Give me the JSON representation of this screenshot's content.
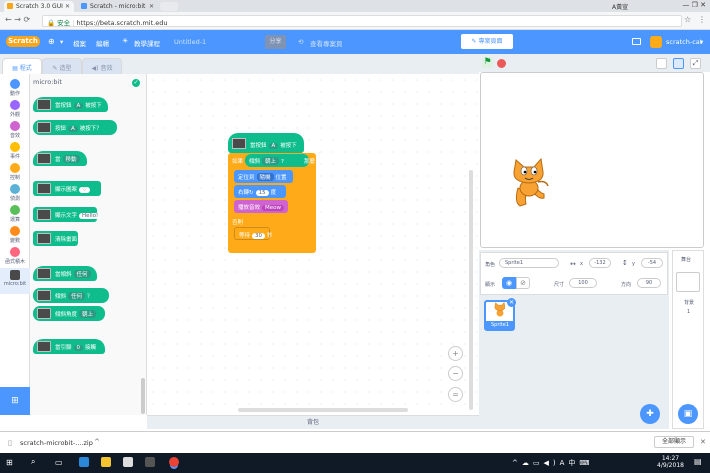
{
  "browser": {
    "tabs": [
      {
        "label": "Scratch 3.0 GUI",
        "active": true
      },
      {
        "label": "Scratch - micro:bit",
        "active": false
      }
    ],
    "user_label": "A黃宣",
    "secure_label": "安全",
    "url": "https://beta.scratch.mit.edu",
    "win_controls": "—  ❐  ✕"
  },
  "menubar": {
    "logo": "Scratch",
    "items": [
      "檔案",
      "編輯",
      "教學課程"
    ],
    "project_title": "Untitled-1",
    "share_label": "分享",
    "remix_label": "查看專案頁",
    "project_page_label": "專案頁面",
    "username": "scratch-cat"
  },
  "editor_tabs": [
    "程式",
    "造型",
    "音效"
  ],
  "categories": [
    {
      "label": "動作",
      "color": "#4c97ff"
    },
    {
      "label": "外觀",
      "color": "#9966ff"
    },
    {
      "label": "音效",
      "color": "#cf63cf"
    },
    {
      "label": "事件",
      "color": "#ffbf00"
    },
    {
      "label": "控制",
      "color": "#ffab19"
    },
    {
      "label": "偵測",
      "color": "#5cb1d6"
    },
    {
      "label": "運算",
      "color": "#59c059"
    },
    {
      "label": "變數",
      "color": "#ff8c1a"
    },
    {
      "label": "函式積木",
      "color": "#ff6680"
    },
    {
      "label": "micro:bit",
      "color": "#0fbd8c"
    }
  ],
  "palette": {
    "title": "micro:bit",
    "blocks": [
      {
        "pre": "當按鈕",
        "dd": "A",
        "post": "被按下",
        "hat": true
      },
      {
        "pre": "按鈕",
        "dd": "A",
        "post": "被按下？",
        "hat": false
      },
      {
        "pre": "當",
        "dd": "移動",
        "post": "",
        "hat": true
      },
      {
        "pre": "顯示圖案",
        "dd": "♡",
        "post": "",
        "hat": false
      },
      {
        "pre": "顯示文字",
        "dd": "Hello!",
        "post": "",
        "hat": false
      },
      {
        "pre": "清除畫面",
        "dd": "",
        "post": "",
        "hat": false
      },
      {
        "pre": "當傾斜",
        "dd": "任何",
        "post": "",
        "hat": true
      },
      {
        "pre": "傾斜",
        "dd": "任何",
        "post": "？",
        "hat": false
      },
      {
        "pre": "傾斜角度",
        "dd": "朝上",
        "post": "",
        "hat": false
      },
      {
        "pre": "當引腳",
        "dd": "0",
        "post": "接觸",
        "hat": true
      }
    ]
  },
  "script": {
    "hat": {
      "pre": "當按鈕",
      "dd": "A",
      "post": "被按下"
    },
    "if_pre": "如果",
    "if_cond_pre": "傾斜",
    "if_cond_dd": "朝上",
    "if_cond_post": "?",
    "if_then": "那麼",
    "goto_pre": "定位到",
    "goto_dd": "隨機",
    "goto_post": "位置",
    "turn_pre": "右轉",
    "turn_val": "15",
    "turn_post": "度",
    "sound_pre": "播放音效",
    "sound_dd": "Meow",
    "else_label": "否則",
    "wait_pre": "等待",
    "wait_val": "30",
    "wait_post": "秒"
  },
  "backpack_label": "背包",
  "sprite_info": {
    "sprite_label": "角色",
    "sprite_name": "Sprite1",
    "x_label": "x",
    "x_value": "-132",
    "y_label": "y",
    "y_value": "-54",
    "show_label": "顯示",
    "size_label": "尺寸",
    "size_value": "100",
    "direction_label": "方向",
    "direction_value": "90"
  },
  "sprite_tile_label": "Sprite1",
  "stage_panel": {
    "title": "舞台",
    "backdrops_label": "背景",
    "backdrops_count": "1"
  },
  "download": {
    "file": "scratch-microbit-....zip",
    "show_all": "全部顯示"
  },
  "taskbar": {
    "time": "14:27",
    "date": "4/9/2018"
  }
}
